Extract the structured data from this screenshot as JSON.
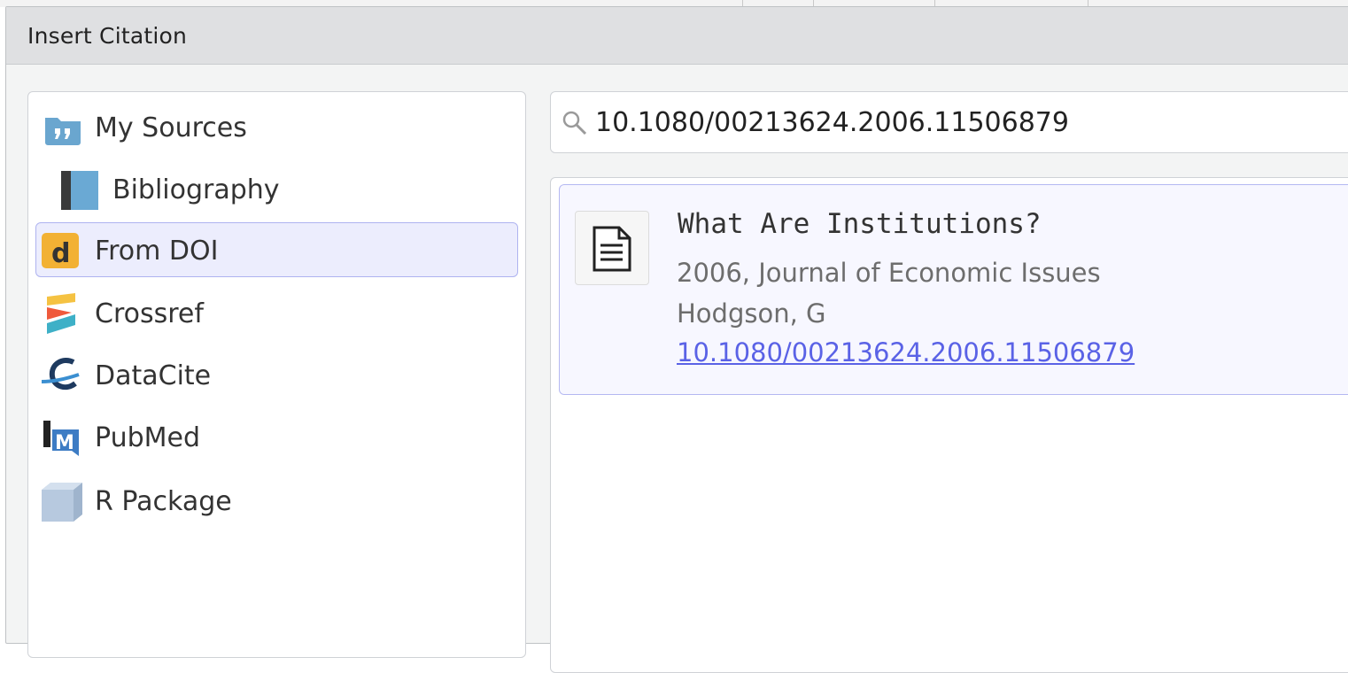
{
  "dialog": {
    "title": "Insert Citation"
  },
  "sources": {
    "items": [
      {
        "label": "My Sources",
        "icon": "quote-folder-icon",
        "selected": false
      },
      {
        "label": "Bibliography",
        "icon": "book-icon",
        "selected": false
      },
      {
        "label": "From DOI",
        "icon": "doi-icon",
        "selected": true
      },
      {
        "label": "Crossref",
        "icon": "crossref-icon",
        "selected": false
      },
      {
        "label": "DataCite",
        "icon": "datacite-icon",
        "selected": false
      },
      {
        "label": "PubMed",
        "icon": "pubmed-icon",
        "selected": false
      },
      {
        "label": "R Package",
        "icon": "package-box-icon",
        "selected": false
      }
    ]
  },
  "search": {
    "value": "10.1080/00213624.2006.11506879"
  },
  "result": {
    "title": "What Are Institutions?",
    "meta": "2006, Journal of Economic Issues",
    "authors": "Hodgson, G",
    "doi": "10.1080/00213624.2006.11506879",
    "icon": "document-icon"
  },
  "colors": {
    "selection_bg": "#ecedfd",
    "selection_border": "#aeb3f0",
    "link": "#5a62e6"
  }
}
